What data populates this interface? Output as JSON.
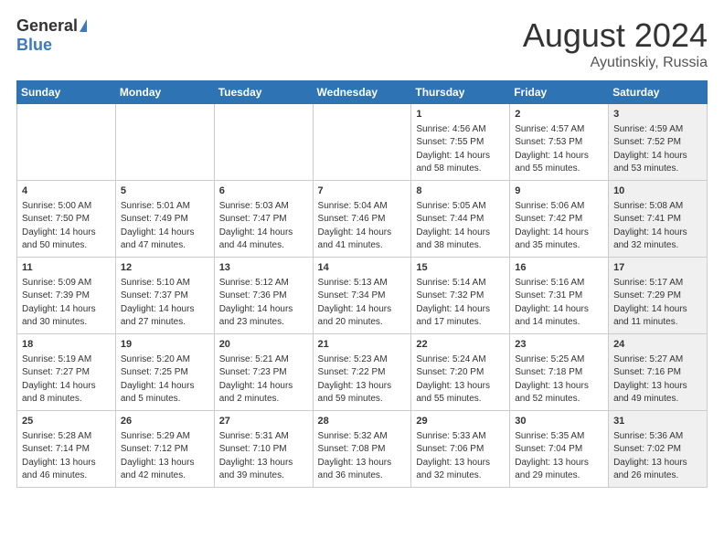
{
  "header": {
    "logo_general": "General",
    "logo_blue": "Blue",
    "title": "August 2024",
    "subtitle": "Ayutinskiy, Russia"
  },
  "days_header": [
    "Sunday",
    "Monday",
    "Tuesday",
    "Wednesday",
    "Thursday",
    "Friday",
    "Saturday"
  ],
  "weeks": [
    [
      {
        "day": "",
        "info": "",
        "shade": false
      },
      {
        "day": "",
        "info": "",
        "shade": false
      },
      {
        "day": "",
        "info": "",
        "shade": false
      },
      {
        "day": "",
        "info": "",
        "shade": false
      },
      {
        "day": "1",
        "info": "Sunrise: 4:56 AM\nSunset: 7:55 PM\nDaylight: 14 hours\nand 58 minutes.",
        "shade": false
      },
      {
        "day": "2",
        "info": "Sunrise: 4:57 AM\nSunset: 7:53 PM\nDaylight: 14 hours\nand 55 minutes.",
        "shade": false
      },
      {
        "day": "3",
        "info": "Sunrise: 4:59 AM\nSunset: 7:52 PM\nDaylight: 14 hours\nand 53 minutes.",
        "shade": true
      }
    ],
    [
      {
        "day": "4",
        "info": "Sunrise: 5:00 AM\nSunset: 7:50 PM\nDaylight: 14 hours\nand 50 minutes.",
        "shade": false
      },
      {
        "day": "5",
        "info": "Sunrise: 5:01 AM\nSunset: 7:49 PM\nDaylight: 14 hours\nand 47 minutes.",
        "shade": false
      },
      {
        "day": "6",
        "info": "Sunrise: 5:03 AM\nSunset: 7:47 PM\nDaylight: 14 hours\nand 44 minutes.",
        "shade": false
      },
      {
        "day": "7",
        "info": "Sunrise: 5:04 AM\nSunset: 7:46 PM\nDaylight: 14 hours\nand 41 minutes.",
        "shade": false
      },
      {
        "day": "8",
        "info": "Sunrise: 5:05 AM\nSunset: 7:44 PM\nDaylight: 14 hours\nand 38 minutes.",
        "shade": false
      },
      {
        "day": "9",
        "info": "Sunrise: 5:06 AM\nSunset: 7:42 PM\nDaylight: 14 hours\nand 35 minutes.",
        "shade": false
      },
      {
        "day": "10",
        "info": "Sunrise: 5:08 AM\nSunset: 7:41 PM\nDaylight: 14 hours\nand 32 minutes.",
        "shade": true
      }
    ],
    [
      {
        "day": "11",
        "info": "Sunrise: 5:09 AM\nSunset: 7:39 PM\nDaylight: 14 hours\nand 30 minutes.",
        "shade": false
      },
      {
        "day": "12",
        "info": "Sunrise: 5:10 AM\nSunset: 7:37 PM\nDaylight: 14 hours\nand 27 minutes.",
        "shade": false
      },
      {
        "day": "13",
        "info": "Sunrise: 5:12 AM\nSunset: 7:36 PM\nDaylight: 14 hours\nand 23 minutes.",
        "shade": false
      },
      {
        "day": "14",
        "info": "Sunrise: 5:13 AM\nSunset: 7:34 PM\nDaylight: 14 hours\nand 20 minutes.",
        "shade": false
      },
      {
        "day": "15",
        "info": "Sunrise: 5:14 AM\nSunset: 7:32 PM\nDaylight: 14 hours\nand 17 minutes.",
        "shade": false
      },
      {
        "day": "16",
        "info": "Sunrise: 5:16 AM\nSunset: 7:31 PM\nDaylight: 14 hours\nand 14 minutes.",
        "shade": false
      },
      {
        "day": "17",
        "info": "Sunrise: 5:17 AM\nSunset: 7:29 PM\nDaylight: 14 hours\nand 11 minutes.",
        "shade": true
      }
    ],
    [
      {
        "day": "18",
        "info": "Sunrise: 5:19 AM\nSunset: 7:27 PM\nDaylight: 14 hours\nand 8 minutes.",
        "shade": false
      },
      {
        "day": "19",
        "info": "Sunrise: 5:20 AM\nSunset: 7:25 PM\nDaylight: 14 hours\nand 5 minutes.",
        "shade": false
      },
      {
        "day": "20",
        "info": "Sunrise: 5:21 AM\nSunset: 7:23 PM\nDaylight: 14 hours\nand 2 minutes.",
        "shade": false
      },
      {
        "day": "21",
        "info": "Sunrise: 5:23 AM\nSunset: 7:22 PM\nDaylight: 13 hours\nand 59 minutes.",
        "shade": false
      },
      {
        "day": "22",
        "info": "Sunrise: 5:24 AM\nSunset: 7:20 PM\nDaylight: 13 hours\nand 55 minutes.",
        "shade": false
      },
      {
        "day": "23",
        "info": "Sunrise: 5:25 AM\nSunset: 7:18 PM\nDaylight: 13 hours\nand 52 minutes.",
        "shade": false
      },
      {
        "day": "24",
        "info": "Sunrise: 5:27 AM\nSunset: 7:16 PM\nDaylight: 13 hours\nand 49 minutes.",
        "shade": true
      }
    ],
    [
      {
        "day": "25",
        "info": "Sunrise: 5:28 AM\nSunset: 7:14 PM\nDaylight: 13 hours\nand 46 minutes.",
        "shade": false
      },
      {
        "day": "26",
        "info": "Sunrise: 5:29 AM\nSunset: 7:12 PM\nDaylight: 13 hours\nand 42 minutes.",
        "shade": false
      },
      {
        "day": "27",
        "info": "Sunrise: 5:31 AM\nSunset: 7:10 PM\nDaylight: 13 hours\nand 39 minutes.",
        "shade": false
      },
      {
        "day": "28",
        "info": "Sunrise: 5:32 AM\nSunset: 7:08 PM\nDaylight: 13 hours\nand 36 minutes.",
        "shade": false
      },
      {
        "day": "29",
        "info": "Sunrise: 5:33 AM\nSunset: 7:06 PM\nDaylight: 13 hours\nand 32 minutes.",
        "shade": false
      },
      {
        "day": "30",
        "info": "Sunrise: 5:35 AM\nSunset: 7:04 PM\nDaylight: 13 hours\nand 29 minutes.",
        "shade": false
      },
      {
        "day": "31",
        "info": "Sunrise: 5:36 AM\nSunset: 7:02 PM\nDaylight: 13 hours\nand 26 minutes.",
        "shade": true
      }
    ]
  ]
}
